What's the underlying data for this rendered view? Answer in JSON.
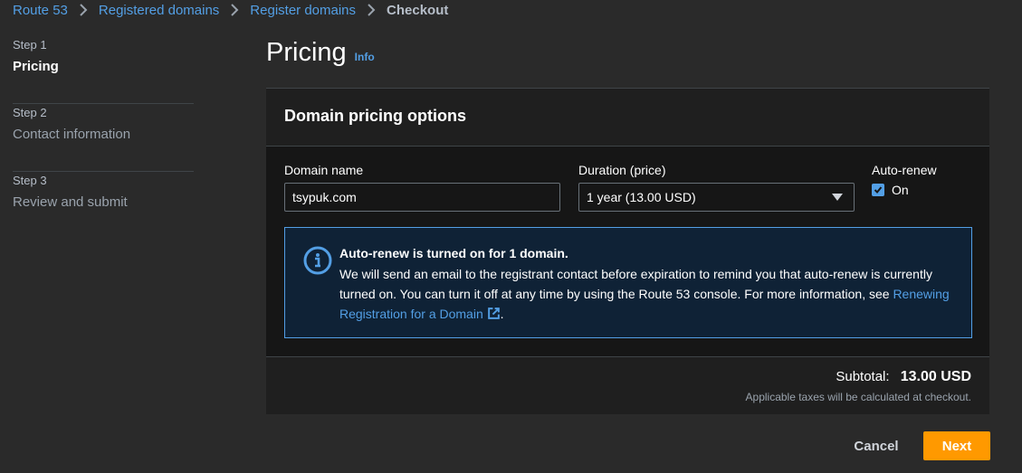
{
  "breadcrumb": {
    "items": [
      "Route 53",
      "Registered domains",
      "Register domains"
    ],
    "current": "Checkout"
  },
  "steps": [
    {
      "number": "Step 1",
      "title": "Pricing",
      "active": true
    },
    {
      "number": "Step 2",
      "title": "Contact information",
      "active": false
    },
    {
      "number": "Step 3",
      "title": "Review and submit",
      "active": false
    }
  ],
  "header": {
    "title": "Pricing",
    "info_link": "Info"
  },
  "panel": {
    "title": "Domain pricing options",
    "domain_label": "Domain name",
    "domain_value": "tsypuk.com",
    "duration_label": "Duration (price)",
    "duration_value": "1 year (13.00 USD)",
    "autorenew_label": "Auto-renew",
    "autorenew_state": "On",
    "autorenew_checked": true
  },
  "alert": {
    "title": "Auto-renew is turned on for 1 domain.",
    "body_pre": "We will send an email to the registrant contact before expiration to remind you that auto-renew is currently turned on. You can turn it off at any time by using the Route 53 console. For more information, see ",
    "link_text": "Renewing Registration for a Domain",
    "body_post": "."
  },
  "footer": {
    "subtotal_label": "Subtotal:",
    "subtotal_value": "13.00 USD",
    "tax_note": "Applicable taxes will be calculated at checkout."
  },
  "actions": {
    "cancel": "Cancel",
    "next": "Next"
  },
  "colors": {
    "accent": "#539fe5",
    "primary_button": "#ff9900",
    "background": "#2a2a2a",
    "panel": "#161616"
  }
}
